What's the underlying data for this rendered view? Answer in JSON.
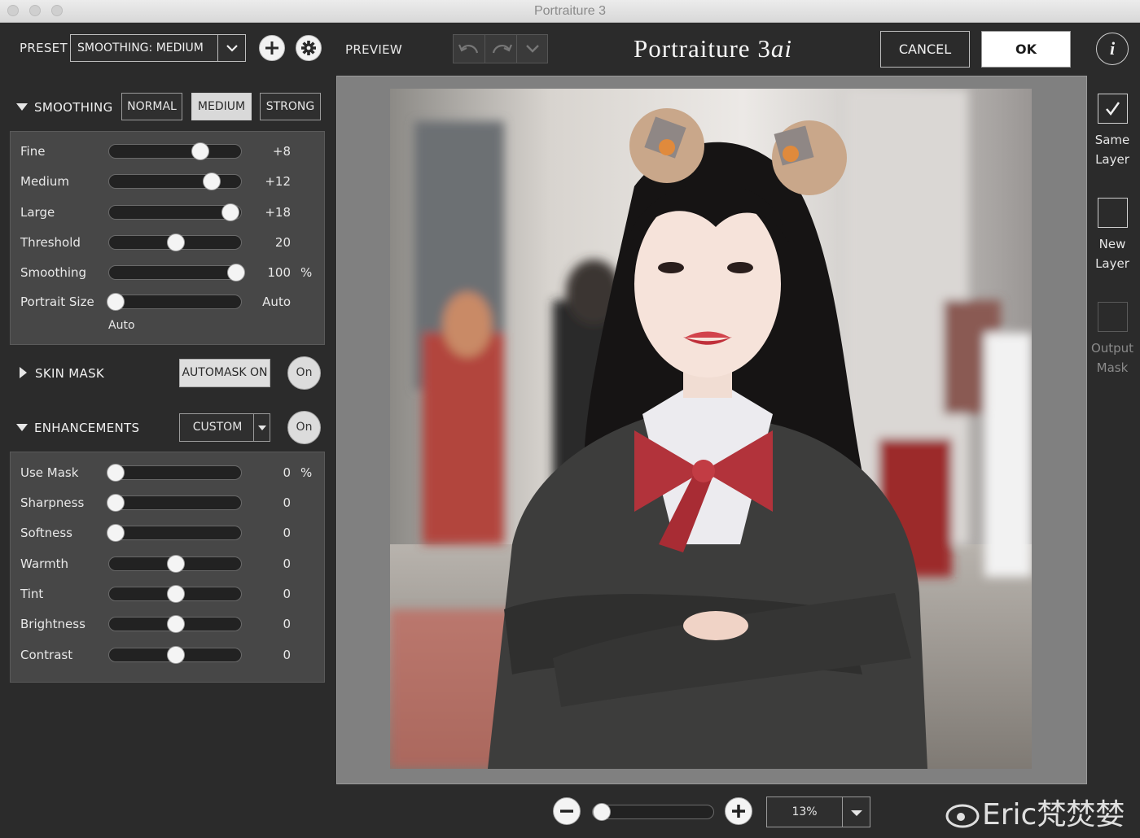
{
  "window": {
    "title": "Portraiture 3"
  },
  "toolbar": {
    "preset_label": "PRESET",
    "preset_value": "SMOOTHING: MEDIUM",
    "preview_label": "PREVIEW",
    "brand_main": "Portraiture 3",
    "brand_ai": "ai",
    "cancel_label": "CANCEL",
    "ok_label": "OK",
    "info_label": "i"
  },
  "smoothing": {
    "title": "SMOOTHING",
    "modes": [
      {
        "label": "NORMAL",
        "active": false
      },
      {
        "label": "MEDIUM",
        "active": true
      },
      {
        "label": "STRONG",
        "active": false
      }
    ],
    "sliders": [
      {
        "label": "Fine",
        "value": "+8",
        "unit": "",
        "fraction": 0.68
      },
      {
        "label": "Medium",
        "value": "+12",
        "unit": "",
        "fraction": 0.77
      },
      {
        "label": "Large",
        "value": "+18",
        "unit": "",
        "fraction": 0.91
      },
      {
        "label": "Threshold",
        "value": "20",
        "unit": "",
        "fraction": 0.5
      },
      {
        "label": "Smoothing",
        "value": "100",
        "unit": "%",
        "fraction": 0.95
      },
      {
        "label": "Portrait Size",
        "value": "Auto",
        "unit": "",
        "fraction": 0.05
      }
    ],
    "portrait_size_note": "Auto"
  },
  "skin_mask": {
    "title": "SKIN MASK",
    "automask_label": "AUTOMASK ON",
    "on_label": "On"
  },
  "enhancements": {
    "title": "ENHANCEMENTS",
    "preset_value": "CUSTOM",
    "on_label": "On",
    "sliders": [
      {
        "label": "Use Mask",
        "value": "0",
        "unit": "%",
        "fraction": 0.05
      },
      {
        "label": "Sharpness",
        "value": "0",
        "unit": "",
        "fraction": 0.05
      },
      {
        "label": "Softness",
        "value": "0",
        "unit": "",
        "fraction": 0.05
      },
      {
        "label": "Warmth",
        "value": "0",
        "unit": "",
        "fraction": 0.5
      },
      {
        "label": "Tint",
        "value": "0",
        "unit": "",
        "fraction": 0.5
      },
      {
        "label": "Brightness",
        "value": "0",
        "unit": "",
        "fraction": 0.5
      },
      {
        "label": "Contrast",
        "value": "0",
        "unit": "",
        "fraction": 0.5
      }
    ]
  },
  "output": {
    "same_layer": {
      "line1": "Same",
      "line2": "Layer",
      "checked": true
    },
    "new_layer": {
      "line1": "New",
      "line2": "Layer",
      "checked": false
    },
    "output_mask": {
      "line1": "Output",
      "line2": "Mask",
      "checked": false,
      "disabled": true
    }
  },
  "zoom": {
    "value": "13%",
    "fraction": 0.07
  },
  "watermark": {
    "text": "Eric梵焚婪"
  }
}
